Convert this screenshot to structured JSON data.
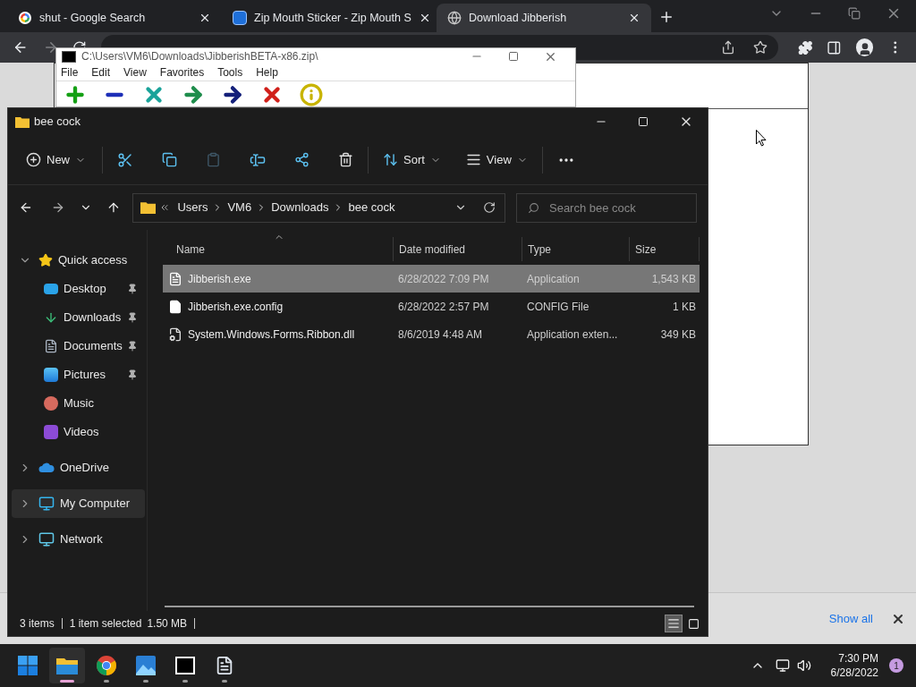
{
  "browser": {
    "tabs": [
      {
        "title": "shut - Google Search",
        "kind": "google",
        "selected": false
      },
      {
        "title": "Zip Mouth Sticker - Zip Mouth S",
        "kind": "gif",
        "selected": false
      },
      {
        "title": "Download Jibberish",
        "kind": "globe",
        "selected": true
      }
    ],
    "download_bar": {
      "show_all": "Show all"
    }
  },
  "archive_window": {
    "title": "C:\\Users\\VM6\\Downloads\\JibberishBETA-x86.zip\\",
    "menu": [
      "File",
      "Edit",
      "View",
      "Favorites",
      "Tools",
      "Help"
    ],
    "tools": [
      {
        "kind": "add"
      },
      {
        "kind": "extract"
      },
      {
        "kind": "test"
      },
      {
        "kind": "copy"
      },
      {
        "kind": "move"
      },
      {
        "kind": "delete"
      },
      {
        "kind": "info"
      }
    ]
  },
  "explorer": {
    "title": "bee cock",
    "commands": {
      "new": "New",
      "sort": "Sort",
      "view": "View"
    },
    "breadcrumb": [
      "Users",
      "VM6",
      "Downloads",
      "bee cock"
    ],
    "search": {
      "placeholder": "Search bee cock"
    },
    "sidebar": [
      {
        "label": "Quick access",
        "kind": "star",
        "expanded": true,
        "selected": false,
        "children": [
          {
            "label": "Desktop",
            "kind": "desktop",
            "pinned": true
          },
          {
            "label": "Downloads",
            "kind": "downloads",
            "pinned": true
          },
          {
            "label": "Documents",
            "kind": "documents",
            "pinned": true
          },
          {
            "label": "Pictures",
            "kind": "pictures",
            "pinned": true
          },
          {
            "label": "Music",
            "kind": "music",
            "pinned": false
          },
          {
            "label": "Videos",
            "kind": "videos",
            "pinned": false
          }
        ]
      },
      {
        "label": "OneDrive",
        "kind": "cloud",
        "expanded": false,
        "selected": false
      },
      {
        "label": "My Computer",
        "kind": "computer",
        "expanded": false,
        "selected": true
      },
      {
        "label": "Network",
        "kind": "network",
        "expanded": false,
        "selected": false
      }
    ],
    "columns": [
      "Name",
      "Date modified",
      "Type",
      "Size"
    ],
    "files": [
      {
        "name": "Jibberish.exe",
        "kind": "exe",
        "date": "6/28/2022 7:09 PM",
        "type": "Application",
        "size": "1,543 KB",
        "selected": true
      },
      {
        "name": "Jibberish.exe.config",
        "kind": "config",
        "date": "6/28/2022 2:57 PM",
        "type": "CONFIG File",
        "size": "1 KB",
        "selected": false
      },
      {
        "name": "System.Windows.Forms.Ribbon.dll",
        "kind": "dll",
        "date": "8/6/2019 4:48 AM",
        "type": "Application exten...",
        "size": "349 KB",
        "selected": false
      }
    ],
    "status": {
      "count": "3 items",
      "selection": "1 item selected",
      "size": "1.50 MB"
    },
    "views": [
      {
        "kind": "details",
        "selected": true
      },
      {
        "kind": "tiles",
        "selected": false
      }
    ]
  },
  "taskbar": {
    "apps": [
      {
        "kind": "start",
        "running": false,
        "active": false
      },
      {
        "kind": "explorer",
        "running": true,
        "active": true
      },
      {
        "kind": "chrome",
        "running": true,
        "active": false
      },
      {
        "kind": "photos",
        "running": true,
        "active": false
      },
      {
        "kind": "archiver",
        "running": true,
        "active": false
      },
      {
        "kind": "notepad",
        "running": true,
        "active": false
      }
    ],
    "clock": {
      "time": "7:30 PM",
      "date": "6/28/2022"
    },
    "notifications": "1"
  }
}
